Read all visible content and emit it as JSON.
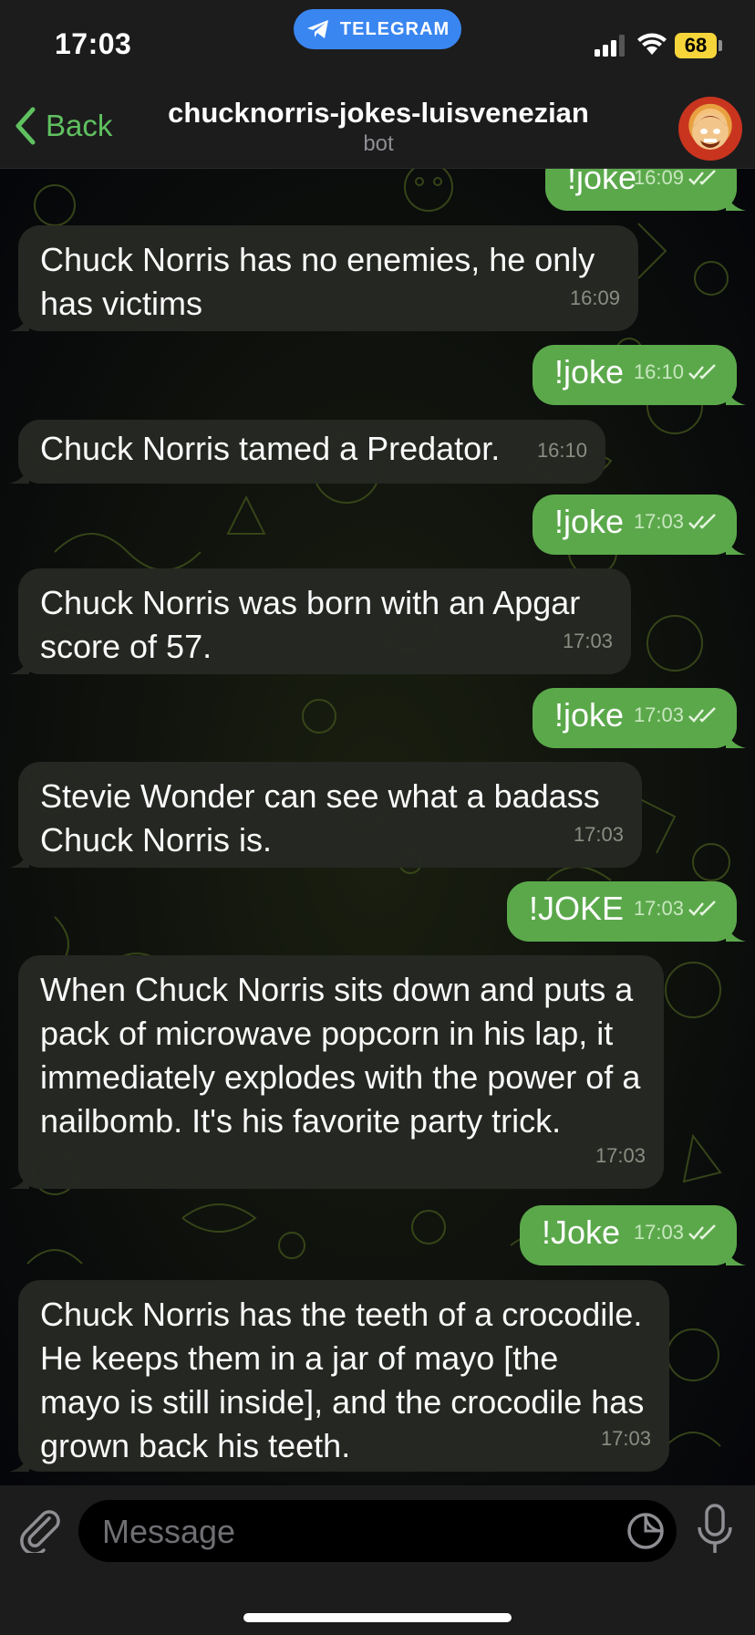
{
  "status_bar": {
    "time": "17:03",
    "app_pill": "TELEGRAM",
    "battery": "68"
  },
  "header": {
    "back_label": "Back",
    "title": "chucknorris-jokes-luisvenezian",
    "subtitle": "bot"
  },
  "messages": [
    {
      "dir": "out",
      "text": "!joke",
      "time": "16:09",
      "read": true
    },
    {
      "dir": "in",
      "text": "Chuck Norris has no enemies, he only has victims",
      "time": "16:09"
    },
    {
      "dir": "out",
      "text": "!joke",
      "time": "16:10",
      "read": true
    },
    {
      "dir": "in",
      "text": "Chuck Norris tamed a Predator.",
      "time": "16:10"
    },
    {
      "dir": "out",
      "text": "!joke",
      "time": "17:03",
      "read": true
    },
    {
      "dir": "in",
      "text": "Chuck Norris was born with an Apgar score of 57.",
      "time": "17:03"
    },
    {
      "dir": "out",
      "text": "!joke",
      "time": "17:03",
      "read": true
    },
    {
      "dir": "in",
      "text": "Stevie Wonder can see what a badass Chuck Norris is.",
      "time": "17:03"
    },
    {
      "dir": "out",
      "text": "!JOKE",
      "time": "17:03",
      "read": true
    },
    {
      "dir": "in",
      "text": "When Chuck Norris sits down and puts a pack of microwave popcorn in his lap, it immediately explodes with the power of a nailbomb. It's his favorite party trick.",
      "time": "17:03"
    },
    {
      "dir": "out",
      "text": "!Joke",
      "time": "17:03",
      "read": true
    },
    {
      "dir": "in",
      "text": "Chuck Norris has the teeth of a crocodile. He keeps them in a jar of mayo [the mayo is still inside], and the crocodile has grown back his teeth.",
      "time": "17:03"
    }
  ],
  "composer": {
    "placeholder": "Message"
  },
  "colors": {
    "outgoing_bubble": "#5ba84b",
    "incoming_bubble": "#262823",
    "accent": "#5fc15f",
    "pill": "#3a86f1",
    "battery": "#f6d53a"
  },
  "icons": [
    "telegram-plane-icon",
    "signal-icon",
    "wifi-icon",
    "battery-icon",
    "chevron-left-icon",
    "double-check-icon",
    "paperclip-icon",
    "sticker-icon",
    "microphone-icon"
  ]
}
